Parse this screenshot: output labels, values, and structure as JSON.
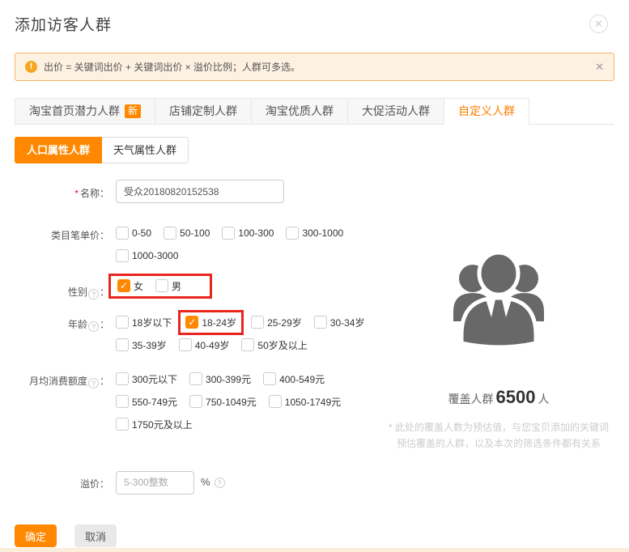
{
  "icons": {
    "close_dialog": "✕",
    "close_notice": "✕",
    "warning": "!",
    "help": "?",
    "check": "✓"
  },
  "punct": {
    "colon": "："
  },
  "dialog": {
    "title": "添加访客人群"
  },
  "notice": {
    "text": "出价 = 关键词出价 + 关键词出价 × 溢价比例；人群可多选。"
  },
  "tabs": [
    {
      "label": "淘宝首页潜力人群",
      "badge": "新",
      "active": false
    },
    {
      "label": "店铺定制人群",
      "active": false
    },
    {
      "label": "淘宝优质人群",
      "active": false
    },
    {
      "label": "大促活动人群",
      "active": false
    },
    {
      "label": "自定义人群",
      "active": true
    }
  ],
  "subtabs": [
    {
      "label": "人口属性人群",
      "active": true
    },
    {
      "label": "天气属性人群",
      "active": false
    }
  ],
  "form": {
    "name": {
      "required": "*",
      "label": "名称",
      "value": "受众20180820152538"
    },
    "unit_price": {
      "label": "类目笔单价",
      "rows": [
        [
          {
            "label": "0-50"
          },
          {
            "label": "50-100"
          },
          {
            "label": "100-300"
          },
          {
            "label": "300-1000"
          }
        ],
        [
          {
            "label": "1000-3000"
          }
        ]
      ]
    },
    "gender": {
      "label": "性别",
      "red_box": true,
      "rows": [
        [
          {
            "label": "女",
            "checked": true
          },
          {
            "label": "男"
          }
        ]
      ]
    },
    "age": {
      "label": "年龄",
      "rows": [
        [
          {
            "label": "18岁以下"
          },
          {
            "label": "18-24岁",
            "checked": true,
            "highlight": true
          },
          {
            "label": "25-29岁"
          },
          {
            "label": "30-34岁"
          }
        ],
        [
          {
            "label": "35-39岁"
          },
          {
            "label": "40-49岁"
          },
          {
            "label": "50岁及以上"
          }
        ]
      ]
    },
    "monthly_spend": {
      "label": "月均消费额度",
      "rows": [
        [
          {
            "label": "300元以下"
          },
          {
            "label": "300-399元"
          },
          {
            "label": "400-549元"
          }
        ],
        [
          {
            "label": "550-749元"
          },
          {
            "label": "750-1049元"
          },
          {
            "label": "1050-1749元"
          }
        ],
        [
          {
            "label": "1750元及以上"
          }
        ]
      ]
    },
    "premium": {
      "label": "溢价",
      "placeholder": "5-300整数",
      "unit": "%"
    }
  },
  "coverage": {
    "label": "覆盖人群",
    "value": "6500",
    "unit": "人",
    "note": "* 此处的覆盖人数为预估值，与您宝贝添加的关键词预估覆盖的人群，以及本次的筛选条件都有关系"
  },
  "footer": {
    "confirm": "确定",
    "cancel": "取消"
  }
}
